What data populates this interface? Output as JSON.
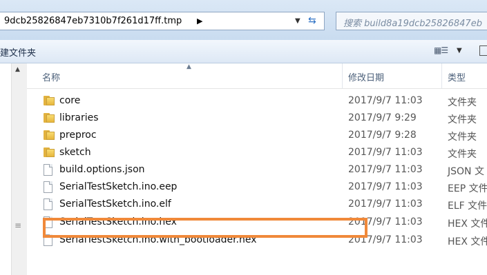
{
  "address": {
    "path": "9dcb25826847eb7310b7f261d17ff.tmp",
    "search_placeholder": "搜索 build8a19dcb25826847eb"
  },
  "toolbar": {
    "new_folder_label": "建文件夹"
  },
  "columns": {
    "name": "名称",
    "date": "修改日期",
    "type": "类型"
  },
  "files": [
    {
      "name": "core",
      "date": "2017/9/7 11:03",
      "type": "文件夹",
      "icon": "folder-icon"
    },
    {
      "name": "libraries",
      "date": "2017/9/7 9:29",
      "type": "文件夹",
      "icon": "folder-icon"
    },
    {
      "name": "preproc",
      "date": "2017/9/7 9:28",
      "type": "文件夹",
      "icon": "folder-icon"
    },
    {
      "name": "sketch",
      "date": "2017/9/7 11:03",
      "type": "文件夹",
      "icon": "folder-icon"
    },
    {
      "name": "build.options.json",
      "date": "2017/9/7 11:03",
      "type": "JSON 文",
      "icon": "file-icon"
    },
    {
      "name": "SerialTestSketch.ino.eep",
      "date": "2017/9/7 11:03",
      "type": "EEP 文件",
      "icon": "file-icon"
    },
    {
      "name": "SerialTestSketch.ino.elf",
      "date": "2017/9/7 11:03",
      "type": "ELF 文件",
      "icon": "file-icon"
    },
    {
      "name": "SerialTestSketch.ino.hex",
      "date": "2017/9/7 11:03",
      "type": "HEX 文件",
      "icon": "file-icon"
    },
    {
      "name": "SerialTestSketch.ino.with_bootloader.hex",
      "date": "2017/9/7 11:03",
      "type": "HEX 文件",
      "icon": "file-icon"
    }
  ],
  "colors": {
    "highlight": "#f0893a"
  }
}
